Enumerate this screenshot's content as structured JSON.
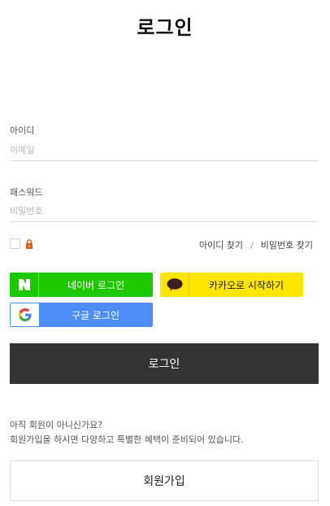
{
  "page": {
    "title": "로그인"
  },
  "form": {
    "id_label": "아이디",
    "id_placeholder": "이메일",
    "pw_label": "패스워드",
    "pw_placeholder": "비밀번호"
  },
  "options": {
    "find_id": "아이디 찾기",
    "separator": "/",
    "find_password": "비밀번호 찾기"
  },
  "social": {
    "naver": {
      "label": "네이버 로그인",
      "icon": "naver-n-icon",
      "color": "#1ec800"
    },
    "kakao": {
      "label": "카카오로 시작하기",
      "icon": "kakao-speech-bubble-icon",
      "color": "#fee500"
    },
    "google": {
      "label": "구글 로그인",
      "icon": "google-g-icon",
      "color": "#4d8df5"
    }
  },
  "login_button": {
    "label": "로그인",
    "color": "#333333"
  },
  "signup": {
    "question": "아직 회원이 아니신가요?",
    "benefit": "회원가입을 하시면 다양하고 특별한 혜택이 준비되어 있습니다.",
    "button_label": "회원가입"
  }
}
